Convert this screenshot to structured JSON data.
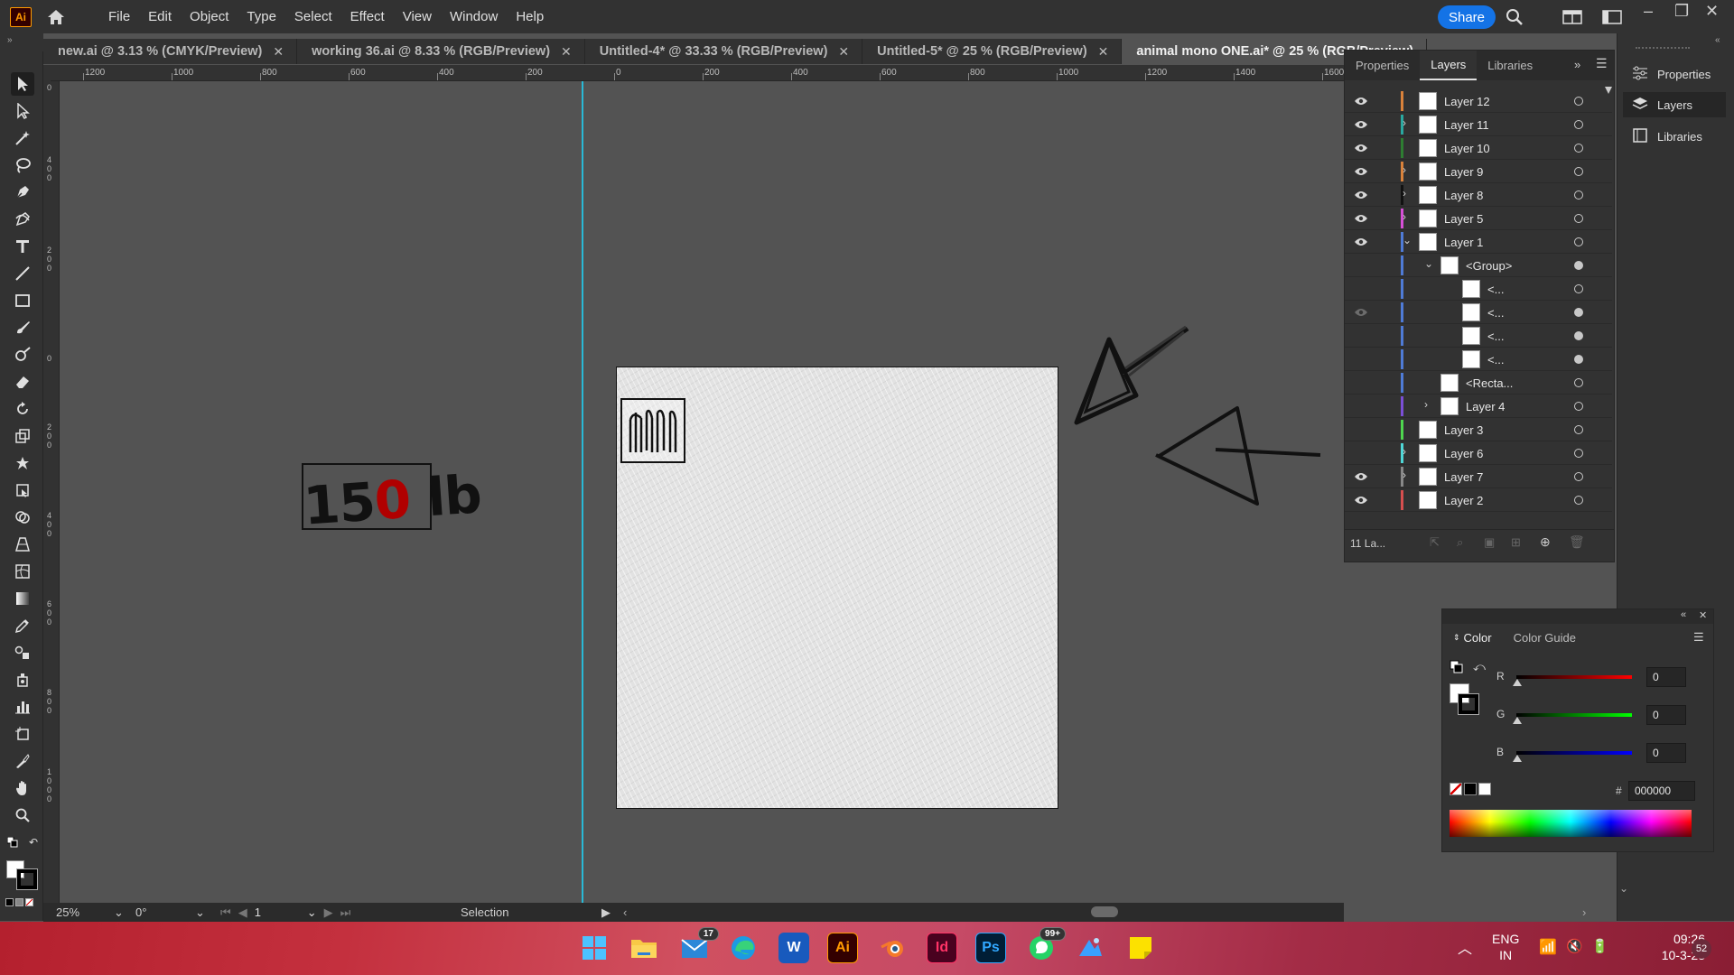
{
  "app": {
    "logo": "Ai",
    "share_label": "Share"
  },
  "menu": [
    "File",
    "Edit",
    "Object",
    "Type",
    "Select",
    "Effect",
    "View",
    "Window",
    "Help"
  ],
  "tabs": [
    {
      "label": "new.ai @ 3.13 % (CMYK/Preview)",
      "active": false
    },
    {
      "label": "working 36.ai @ 8.33 % (RGB/Preview)",
      "active": false
    },
    {
      "label": "Untitled-4* @ 33.33 % (RGB/Preview)",
      "active": false
    },
    {
      "label": "Untitled-5* @ 25 % (RGB/Preview)",
      "active": false
    },
    {
      "label": "animal mono ONE.ai* @ 25 % (RGB/Preview)",
      "active": true
    }
  ],
  "ruler": {
    "h": [
      "1200",
      "1000",
      "800",
      "600",
      "400",
      "200",
      "0",
      "200",
      "400",
      "600",
      "800",
      "1000",
      "1200",
      "1400",
      "1600"
    ],
    "v": [
      "0",
      "400",
      "200",
      "0",
      "200",
      "400",
      "600",
      "800",
      "1000"
    ]
  },
  "canvas": {
    "label_text_a": "15",
    "label_text_red": "0",
    "label_text_b": " lb"
  },
  "status": {
    "zoom": "25%",
    "rotation": "0°",
    "artboard": "1",
    "tool": "Selection"
  },
  "layers_panel": {
    "tabs": [
      "Properties",
      "Layers",
      "Libraries"
    ],
    "active_tab": "Layers",
    "count": "11 La...",
    "rows": [
      {
        "name": "Layer 12",
        "visible": true,
        "color": "#d9823b",
        "expand": "",
        "indent": 0,
        "target": "empty"
      },
      {
        "name": "Layer 11",
        "visible": true,
        "color": "#2aa8a0",
        "expand": "›",
        "indent": 0,
        "target": "empty"
      },
      {
        "name": "Layer 10",
        "visible": true,
        "color": "#2e7d32",
        "expand": "",
        "indent": 0,
        "target": "empty"
      },
      {
        "name": "Layer 9",
        "visible": true,
        "color": "#d9823b",
        "expand": "›",
        "indent": 0,
        "target": "empty"
      },
      {
        "name": "Layer 8",
        "visible": true,
        "color": "#111111",
        "expand": "›",
        "indent": 0,
        "target": "empty"
      },
      {
        "name": "Layer 5",
        "visible": true,
        "color": "#d64fd6",
        "expand": "›",
        "indent": 0,
        "target": "empty"
      },
      {
        "name": "Layer 1",
        "visible": true,
        "color": "#4f7bd6",
        "expand": "⌄",
        "indent": 0,
        "target": "empty"
      },
      {
        "name": "<Group>",
        "visible": false,
        "color": "#4f7bd6",
        "expand": "⌄",
        "indent": 1,
        "target": "filled"
      },
      {
        "name": "<...",
        "visible": false,
        "color": "#4f7bd6",
        "expand": "",
        "indent": 2,
        "target": "empty"
      },
      {
        "name": "<...",
        "visible": false,
        "color": "#4f7bd6",
        "expand": "",
        "indent": 2,
        "target": "filled",
        "dim_eye": true
      },
      {
        "name": "<...",
        "visible": false,
        "color": "#4f7bd6",
        "expand": "",
        "indent": 2,
        "target": "filled"
      },
      {
        "name": "<...",
        "visible": false,
        "color": "#4f7bd6",
        "expand": "",
        "indent": 2,
        "target": "filled"
      },
      {
        "name": "<Recta...",
        "visible": false,
        "color": "#4f7bd6",
        "expand": "",
        "indent": 1,
        "target": "empty"
      },
      {
        "name": "Layer 4",
        "visible": false,
        "color": "#7b4fd6",
        "expand": "›",
        "indent": 1,
        "target": "empty"
      },
      {
        "name": "Layer 3",
        "visible": false,
        "color": "#4fd64f",
        "expand": "",
        "indent": 0,
        "target": "empty"
      },
      {
        "name": "Layer 6",
        "visible": false,
        "color": "#4fd6d6",
        "expand": "›",
        "indent": 0,
        "target": "empty"
      },
      {
        "name": "Layer 7",
        "visible": true,
        "color": "#888888",
        "expand": "›",
        "indent": 0,
        "target": "empty"
      },
      {
        "name": "Layer 2",
        "visible": true,
        "color": "#d64f4f",
        "expand": "",
        "indent": 0,
        "target": "empty"
      }
    ]
  },
  "dock": [
    {
      "label": "Properties",
      "icon": "properties-icon"
    },
    {
      "label": "Layers",
      "icon": "layers-icon"
    },
    {
      "label": "Libraries",
      "icon": "libraries-icon"
    }
  ],
  "color_panel": {
    "tabs": [
      "Color",
      "Color Guide"
    ],
    "r_label": "R",
    "g_label": "G",
    "b_label": "B",
    "r": "0",
    "g": "0",
    "b": "0",
    "hex_label": "#",
    "hex": "000000"
  },
  "taskbar": {
    "mail_badge": "17",
    "whatsapp_badge": "99+",
    "lang": "ENG",
    "region": "IN",
    "time": "09:26",
    "date": "10-3-23",
    "notifications": "52"
  }
}
